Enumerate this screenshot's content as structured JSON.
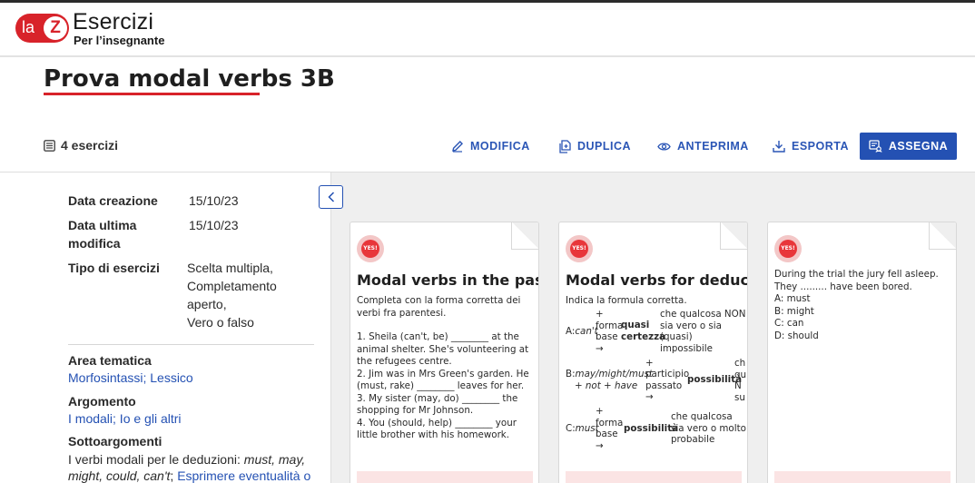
{
  "header": {
    "logo_la": "la",
    "logo_z": "Z",
    "brand_title": "Esercizi",
    "brand_subtitle": "Per l’insegnante"
  },
  "page": {
    "title": "Prova modal verbs 3B",
    "exercise_count": "4 esercizi"
  },
  "toolbar": {
    "edit_label": "MODIFICA",
    "duplicate_label": "DUPLICA",
    "preview_label": "ANTEPRIMA",
    "export_label": "ESPORTA",
    "assign_label": "ASSEGNA"
  },
  "details": {
    "created_label": "Data creazione",
    "created_value": "15/10/23",
    "modified_label_1": "Data ultima",
    "modified_label_2": "modifica",
    "modified_value": "15/10/23",
    "type_label": "Tipo di esercizi",
    "types": [
      "Scelta multipla,",
      "Completamento",
      "aperto,",
      "Vero o falso"
    ],
    "area_label": "Area tematica",
    "area_value": "Morfosintassi; Lessico",
    "topic_label": "Argomento",
    "topic_value": "I modali; Io e gli altri",
    "subtopic_label": "Sottoargomenti",
    "subtopic_text_1": "I verbi modali per le deduzioni: ",
    "subtopic_italic_1": "must, may,",
    "subtopic_italic_2": "might, could, can't",
    "subtopic_text_2": "; ",
    "subtopic_link": "Esprimere eventualità o"
  },
  "cards": [
    {
      "badge": "YES!",
      "title": "Modal verbs in the past",
      "instruction": "Completa con la forma corretta dei verbi fra parentesi.",
      "items": [
        "1. Sheila (can't, be) ________ at the animal shelter. She's volunteering at the refugees centre.",
        "2. Jim was in Mrs Green's garden. He (must, rake) ________ leaves for her.",
        "3. My sister (may, do) ________ the shopping for Mr Johnson.",
        "4. You (should, help) ________ your little brother with his homework."
      ]
    },
    {
      "badge": "YES!",
      "title": "Modal verbs for deduction",
      "instruction": "Indica la formula corretta.",
      "row1": {
        "a": "A:",
        "verb": "can't",
        "plus": "+",
        "form1": "forma",
        "form2": "base",
        "arrow": "→",
        "kw1": "quasi",
        "kw2": "certezza",
        "desc1": "che qualcosa NON",
        "desc2": "sia vero o sia",
        "desc3": "(quasi)",
        "desc4": "impossibile"
      },
      "row2": {
        "b": "B:",
        "verb1": "may/might/must",
        "verb2": "+ not + have",
        "plus": "+",
        "form1": "participio",
        "form2": "passato",
        "arrow": "→",
        "kw": "possibilità",
        "cut1": "ch",
        "cut2": "qu",
        "cut3": "N",
        "cut4": "su"
      },
      "row3": {
        "c": "C:",
        "verb": "must",
        "plus": "+",
        "form1": "forma",
        "form2": "base",
        "arrow": "→",
        "kw": "possibilità",
        "desc1": "che qualcosa",
        "desc2": "sia vero o molto",
        "desc3": "probabile"
      }
    },
    {
      "badge": "YES!",
      "question": "During the trial the jury fell asleep. They ......... have been bored.",
      "options": [
        "A: must",
        "B: might",
        "C: can",
        "D: should"
      ]
    }
  ],
  "colors": {
    "brand_red": "#d8232a",
    "primary_blue": "#2451b3",
    "panel_bg": "#efefef"
  }
}
